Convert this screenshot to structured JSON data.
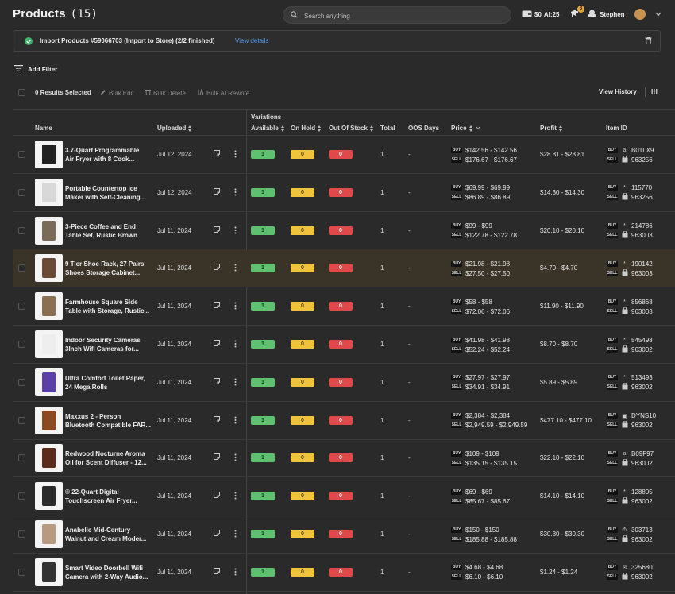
{
  "header": {
    "title": "Products",
    "count": "(15)",
    "search_placeholder": "Search anything",
    "balance": "$0",
    "ai_credits": "AI:25",
    "notification_count": "3",
    "user_name": "Stephen"
  },
  "banner": {
    "message": "Import Products #59066703 (Import to Store) (2/2 finished)",
    "link": "View details"
  },
  "toolbar": {
    "add_filter": "Add Filter",
    "selected": "0 Results Selected",
    "bulk_edit": "Bulk Edit",
    "bulk_delete": "Bulk Delete",
    "bulk_ai_rewrite": "Bulk AI Rewrite",
    "view_history": "View History"
  },
  "columns": {
    "variations": "Variations",
    "name": "Name",
    "uploaded": "Uploaded",
    "available": "Available",
    "on_hold": "On Hold",
    "out_of_stock": "Out Of Stock",
    "total": "Total",
    "oos_days": "OOS Days",
    "price": "Price",
    "profit": "Profit",
    "item_id": "Item ID"
  },
  "tags": {
    "buy": "BUY",
    "sell": "SELL"
  },
  "rows": [
    {
      "name1": "3.7-Quart Programmable",
      "name2": "Air Fryer with 8 Cook...",
      "date": "Jul 12, 2024",
      "available": "1",
      "on_hold": "0",
      "oos": "0",
      "total": "1",
      "oos_days": "-",
      "buy": "$142.56 - $142.56",
      "sell": "$176.67 - $176.67",
      "profit": "$28.81 - $28.81",
      "buy_id": "B01LX9",
      "sell_id": "963256",
      "thumb_color": "#222222",
      "source_icon": "a"
    },
    {
      "name1": "Portable Countertop Ice",
      "name2": "Maker with Self-Cleaning...",
      "date": "Jul 12, 2024",
      "available": "1",
      "on_hold": "0",
      "oos": "0",
      "total": "1",
      "oos_days": "-",
      "buy": "$69.99 - $69.99",
      "sell": "$86.89 - $86.89",
      "profit": "$14.30 - $14.30",
      "buy_id": "115770",
      "sell_id": "963256",
      "thumb_color": "#d8d8d8",
      "source_icon": "*"
    },
    {
      "name1": "3-Piece Coffee and End",
      "name2": "Table Set, Rustic Brown",
      "date": "Jul 11, 2024",
      "available": "1",
      "on_hold": "0",
      "oos": "0",
      "total": "1",
      "oos_days": "-",
      "buy": "$99 - $99",
      "sell": "$122.78 - $122.78",
      "profit": "$20.10 - $20.10",
      "buy_id": "214786",
      "sell_id": "963003",
      "thumb_color": "#7a6a58",
      "source_icon": "*"
    },
    {
      "name1": "9 Tier Shoe Rack, 27 Pairs",
      "name2": "Shoes Storage Cabinet...",
      "date": "Jul 11, 2024",
      "available": "1",
      "on_hold": "0",
      "oos": "0",
      "total": "1",
      "oos_days": "-",
      "buy": "$21.98 - $21.98",
      "sell": "$27.50 - $27.50",
      "profit": "$4.70 - $4.70",
      "buy_id": "190142",
      "sell_id": "963003",
      "thumb_color": "#6b4a36",
      "source_icon": "*"
    },
    {
      "name1": "Farmhouse Square Side",
      "name2": "Table with Storage, Rustic...",
      "date": "Jul 11, 2024",
      "available": "1",
      "on_hold": "0",
      "oos": "0",
      "total": "1",
      "oos_days": "-",
      "buy": "$58 - $58",
      "sell": "$72.06 - $72.06",
      "profit": "$11.90 - $11.90",
      "buy_id": "856868",
      "sell_id": "963003",
      "thumb_color": "#8a6f52",
      "source_icon": "*"
    },
    {
      "name1": "Indoor Security Cameras",
      "name2": "3Inch Wifi Cameras for...",
      "date": "Jul 11, 2024",
      "available": "1",
      "on_hold": "0",
      "oos": "0",
      "total": "1",
      "oos_days": "-",
      "buy": "$41.98 - $41.98",
      "sell": "$52.24 - $52.24",
      "profit": "$8.70 - $8.70",
      "buy_id": "545498",
      "sell_id": "963002",
      "thumb_color": "#eeeeee",
      "source_icon": "*"
    },
    {
      "name1": "Ultra Comfort Toilet Paper,",
      "name2": "24 Mega Rolls",
      "date": "Jul 11, 2024",
      "available": "1",
      "on_hold": "0",
      "oos": "0",
      "total": "1",
      "oos_days": "-",
      "buy": "$27.97 - $27.97",
      "sell": "$34.91 - $34.91",
      "profit": "$5.89 - $5.89",
      "buy_id": "513493",
      "sell_id": "963002",
      "thumb_color": "#5a3fa8",
      "source_icon": "*"
    },
    {
      "name1": "Maxxus 2 - Person",
      "name2": "Bluetooth Compatible FAR...",
      "date": "Jul 11, 2024",
      "available": "1",
      "on_hold": "0",
      "oos": "0",
      "total": "1",
      "oos_days": "-",
      "buy": "$2,384 - $2,384",
      "sell": "$2,949.59 - $2,949.59",
      "profit": "$477.10 - $477.10",
      "buy_id": "DYNS10",
      "sell_id": "963002",
      "thumb_color": "#8a4a22",
      "source_icon": "▣"
    },
    {
      "name1": "Redwood Nocturne Aroma",
      "name2": "Oil for Scent Diffuser - 12...",
      "date": "Jul 11, 2024",
      "available": "1",
      "on_hold": "0",
      "oos": "0",
      "total": "1",
      "oos_days": "-",
      "buy": "$109 - $109",
      "sell": "$135.15 - $135.15",
      "profit": "$22.10 - $22.10",
      "buy_id": "B09F97",
      "sell_id": "963002",
      "thumb_color": "#5a2c1c",
      "source_icon": "a"
    },
    {
      "name1": "® 22-Quart Digital",
      "name2": "Touchscreen Air Fryer...",
      "date": "Jul 11, 2024",
      "available": "1",
      "on_hold": "0",
      "oos": "0",
      "total": "1",
      "oos_days": "-",
      "buy": "$69 - $69",
      "sell": "$85.67 - $85.67",
      "profit": "$14.10 - $14.10",
      "buy_id": "128805",
      "sell_id": "963002",
      "thumb_color": "#2b2b2b",
      "source_icon": "*"
    },
    {
      "name1": "Anabelle Mid-Century",
      "name2": "Walnut and Cream Moder...",
      "date": "Jul 11, 2024",
      "available": "1",
      "on_hold": "0",
      "oos": "0",
      "total": "1",
      "oos_days": "-",
      "buy": "$150 - $150",
      "sell": "$185.88 - $185.88",
      "profit": "$30.30 - $30.30",
      "buy_id": "303713",
      "sell_id": "963002",
      "thumb_color": "#b89a80",
      "source_icon": "⁂"
    },
    {
      "name1": "Smart Video Doorbell Wifi",
      "name2": "Camera with 2-Way Audio...",
      "date": "Jul 11, 2024",
      "available": "1",
      "on_hold": "0",
      "oos": "0",
      "total": "1",
      "oos_days": "-",
      "buy": "$4.68 - $4.68",
      "sell": "$6.10 - $6.10",
      "profit": "$1.24 - $1.24",
      "buy_id": "325680",
      "sell_id": "963002",
      "thumb_color": "#333333",
      "source_icon": "✉"
    }
  ]
}
